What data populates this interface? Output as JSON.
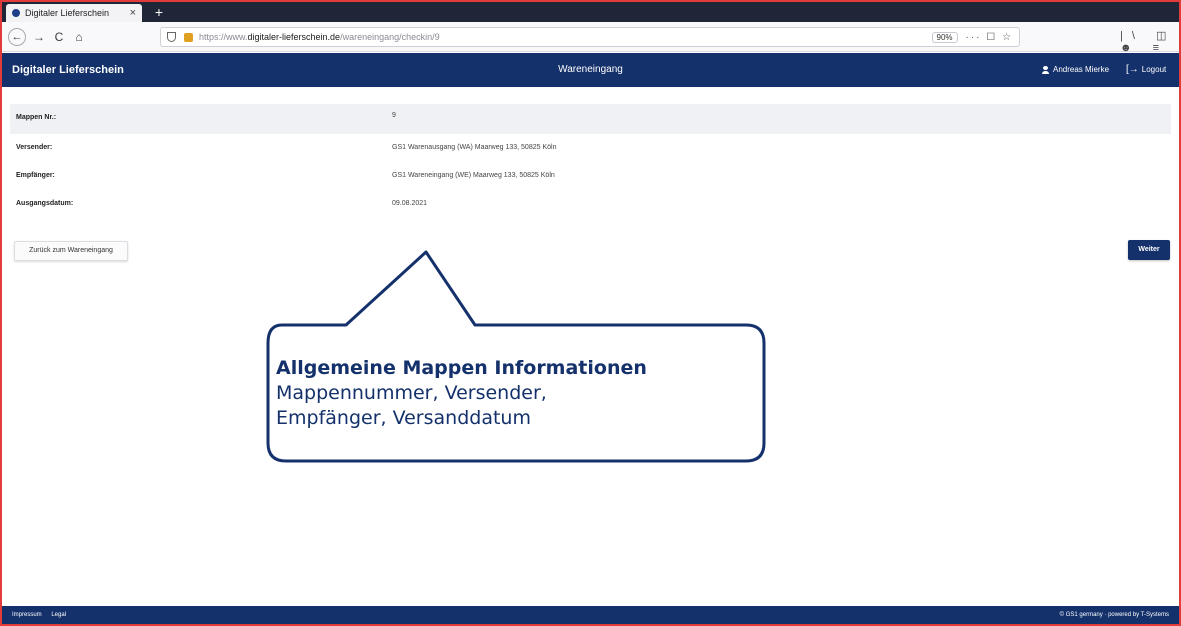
{
  "colors": {
    "brand_navy": "#14316b",
    "frame_red": "#e23b3b",
    "tabstrip_dark": "#1f2638"
  },
  "browser": {
    "tab_title": "Digitaler Lieferschein",
    "tab_close": "×",
    "new_tab": "+",
    "nav": {
      "back": "←",
      "forward": "→",
      "reload": "C",
      "home": "⌂"
    },
    "url": {
      "prefix": "https://www.",
      "host": "digitaler-lieferschein.de",
      "path": "/wareneingang/checkin/9"
    },
    "zoom": "90%",
    "url_tools": "··· ☐ ☆",
    "toolbar_icons": "|\\ ◫ ☻ ≡"
  },
  "header": {
    "brand": "Digitaler Lieferschein",
    "title": "Wareneingang",
    "user_name": "Andreas Mierke",
    "logout_icon": "[→",
    "logout": "Logout"
  },
  "info": {
    "rows": [
      {
        "label": "Mappen Nr.:",
        "value": "9"
      },
      {
        "label": "Versender:",
        "value": "GS1 Warenausgang (WA) Maarweg 133, 50825 Köln"
      },
      {
        "label": "Empfänger:",
        "value": "GS1 Wareneingang (WE) Maarweg 133, 50825 Köln"
      },
      {
        "label": "Ausgangsdatum:",
        "value": "09.08.2021"
      }
    ]
  },
  "buttons": {
    "back": "Zurück zum Wareneingang",
    "next": "Weiter"
  },
  "callout": {
    "title": "Allgemeine Mappen Informationen",
    "line1": "Mappennummer, Versender,",
    "line2": "Empfänger, Versanddatum"
  },
  "footer": {
    "links": [
      "Impressum",
      "Legal"
    ],
    "right": "© GS1 germany · powered by T-Systems"
  }
}
